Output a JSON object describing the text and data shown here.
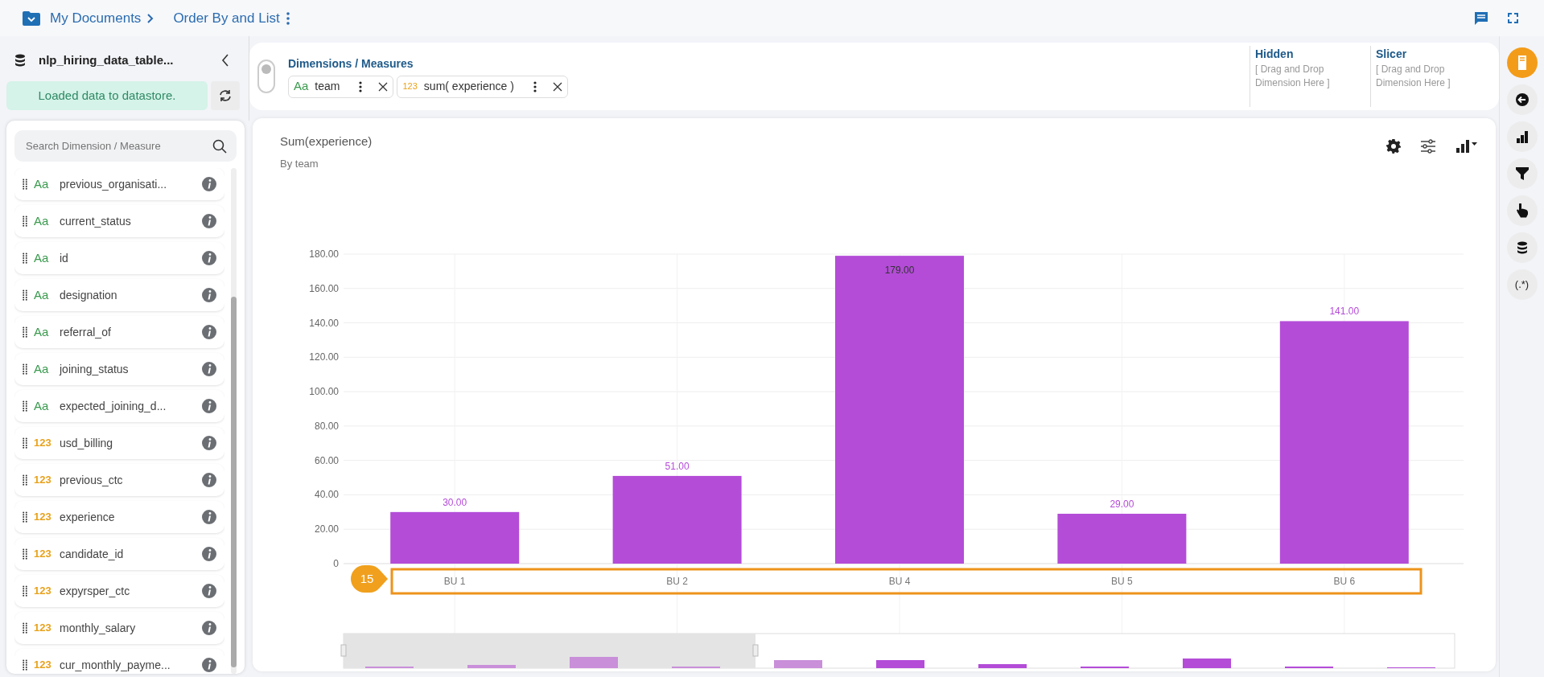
{
  "breadcrumb": {
    "root": "My Documents",
    "current": "Order By and List"
  },
  "datasource": {
    "name": "nlp_hiring_data_table...",
    "status": "Loaded data to datastore."
  },
  "search": {
    "placeholder": "Search Dimension / Measure"
  },
  "fields": [
    {
      "kind": "dimension",
      "type": "Aa",
      "name": "previous_organisati..."
    },
    {
      "kind": "dimension",
      "type": "Aa",
      "name": "current_status"
    },
    {
      "kind": "dimension",
      "type": "Aa",
      "name": "id"
    },
    {
      "kind": "dimension",
      "type": "Aa",
      "name": "designation"
    },
    {
      "kind": "dimension",
      "type": "Aa",
      "name": "referral_of"
    },
    {
      "kind": "dimension",
      "type": "Aa",
      "name": "joining_status"
    },
    {
      "kind": "dimension",
      "type": "Aa",
      "name": "expected_joining_d..."
    },
    {
      "kind": "measure",
      "type": "123",
      "name": "usd_billing"
    },
    {
      "kind": "measure",
      "type": "123",
      "name": "previous_ctc"
    },
    {
      "kind": "measure",
      "type": "123",
      "name": "experience"
    },
    {
      "kind": "measure",
      "type": "123",
      "name": "candidate_id"
    },
    {
      "kind": "measure",
      "type": "123",
      "name": "expyrsper_ctc"
    },
    {
      "kind": "measure",
      "type": "123",
      "name": "monthly_salary"
    },
    {
      "kind": "measure",
      "type": "123",
      "name": "cur_monthly_payme..."
    }
  ],
  "layout_toggle": {
    "on": false
  },
  "dimensions_measures": {
    "title": "Dimensions / Measures",
    "chips": [
      {
        "kind": "dimension",
        "type": "Aa",
        "name": "team"
      },
      {
        "kind": "measure",
        "type": "123",
        "name": "sum( experience )"
      }
    ]
  },
  "drop_zones": [
    {
      "title": "Hidden",
      "hint": "[ Drag and Drop Dimension Here ]"
    },
    {
      "title": "Slicer",
      "hint": "[ Drag and Drop Dimension Here ]"
    }
  ],
  "chart": {
    "title": "Sum(experience)",
    "subtitle": "By team",
    "callout": "15",
    "chart_data": {
      "type": "bar",
      "categories": [
        "BU 1",
        "BU 2",
        "BU 4",
        "BU 5",
        "BU 6"
      ],
      "series": [
        {
          "color": "#b44cd8",
          "values": [
            30,
            51,
            179,
            29,
            141
          ]
        }
      ],
      "ylim": [
        0,
        180
      ],
      "yticks": [
        {
          "value": 0,
          "label": "0"
        },
        {
          "value": 20,
          "label": "20.00"
        },
        {
          "value": 40,
          "label": "40.00"
        },
        {
          "value": 60,
          "label": "60.00"
        },
        {
          "value": 80,
          "label": "80.00"
        },
        {
          "value": 100,
          "label": "100.00"
        },
        {
          "value": 120,
          "label": "120.00"
        },
        {
          "value": 140,
          "label": "140.00"
        },
        {
          "value": 160,
          "label": "160.00"
        },
        {
          "value": 180,
          "label": "180.00"
        }
      ],
      "grid": true,
      "value_labels": [
        "30.00",
        "51.00",
        "179.00",
        "29.00",
        "141.00"
      ]
    }
  },
  "rail": [
    {
      "kind": "card",
      "selected": true
    },
    {
      "kind": "back",
      "selected": false
    },
    {
      "kind": "chart",
      "selected": false
    },
    {
      "kind": "filter",
      "selected": false
    },
    {
      "kind": "pointer",
      "selected": false
    },
    {
      "kind": "database",
      "selected": false
    },
    {
      "kind": "regex",
      "label": "(.*)",
      "selected": false
    }
  ]
}
